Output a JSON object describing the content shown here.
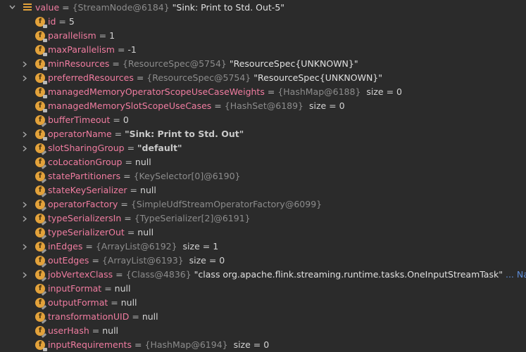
{
  "root": {
    "name": "value",
    "ref": "{StreamNode@6184}",
    "value": "\"Sink: Print to Std. Out-5\""
  },
  "fields": [
    {
      "name": "id",
      "value": "5"
    },
    {
      "name": "parallelism",
      "value": "1"
    },
    {
      "name": "maxParallelism",
      "value": "-1"
    },
    {
      "name": "minResources",
      "ref": "{ResourceSpec@5754}",
      "value": "\"ResourceSpec{UNKNOWN}\""
    },
    {
      "name": "preferredResources",
      "ref": "{ResourceSpec@5754}",
      "value": "\"ResourceSpec{UNKNOWN}\""
    },
    {
      "name": "managedMemoryOperatorScopeUseCaseWeights",
      "ref": "{HashMap@6188}",
      "extra": "size = 0"
    },
    {
      "name": "managedMemorySlotScopeUseCases",
      "ref": "{HashSet@6189}",
      "extra": "size = 0"
    },
    {
      "name": "bufferTimeout",
      "value": "0"
    },
    {
      "name": "operatorName",
      "value": "\"Sink: Print to Std. Out\""
    },
    {
      "name": "slotSharingGroup",
      "value": "\"default\""
    },
    {
      "name": "coLocationGroup",
      "value": "null"
    },
    {
      "name": "statePartitioners",
      "ref": "{KeySelector[0]@6190}"
    },
    {
      "name": "stateKeySerializer",
      "value": "null"
    },
    {
      "name": "operatorFactory",
      "ref": "{SimpleUdfStreamOperatorFactory@6099}"
    },
    {
      "name": "typeSerializersIn",
      "ref": "{TypeSerializer[2]@6191}"
    },
    {
      "name": "typeSerializerOut",
      "value": "null"
    },
    {
      "name": "inEdges",
      "ref": "{ArrayList@6192}",
      "extra": "size = 1"
    },
    {
      "name": "outEdges",
      "ref": "{ArrayList@6193}",
      "extra": "size = 0"
    },
    {
      "name": "jobVertexClass",
      "ref": "{Class@4836}",
      "value": "\"class org.apache.flink.streaming.runtime.tasks.OneInputStreamTask\"",
      "link": "... Navig"
    },
    {
      "name": "inputFormat",
      "value": "null"
    },
    {
      "name": "outputFormat",
      "value": "null"
    },
    {
      "name": "transformationUID",
      "value": "null"
    },
    {
      "name": "userHash",
      "value": "null"
    },
    {
      "name": "inputRequirements",
      "ref": "{HashMap@6194}",
      "extra": "size = 0"
    }
  ],
  "symbols": {
    "field_icon_letter": "f",
    "equals": "="
  }
}
